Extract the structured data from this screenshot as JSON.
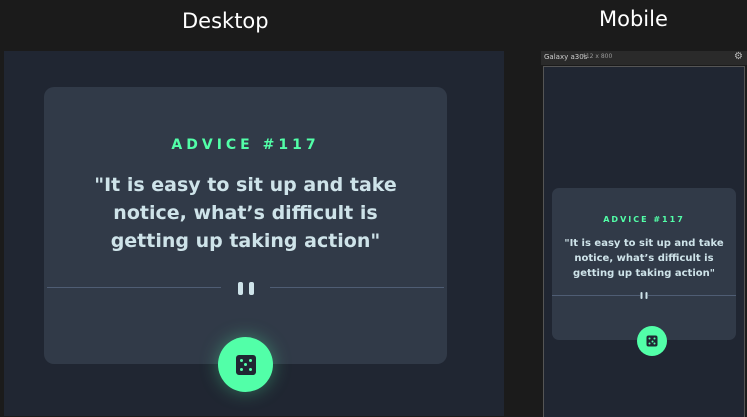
{
  "labels": {
    "desktop": "Desktop",
    "mobile": "Mobile"
  },
  "desktop": {
    "advice_heading": "ADVICE #117",
    "quote": "\"It is easy to sit up and take notice, what’s difficult is getting up taking action\"",
    "dice_icon": "dice-icon",
    "divider_icon": "pause-icon"
  },
  "mobile": {
    "device_name": "Galaxy a30s",
    "device_dimensions": "412 x 800",
    "settings_icon": "gear-icon",
    "advice_heading": "ADVICE #117",
    "quote": "\"It is easy to sit up and take notice, what’s difficult is getting up taking action\"",
    "dice_icon": "dice-icon"
  },
  "colors": {
    "accent": "#52ffa8",
    "card": "#313a48",
    "background": "#202632",
    "text": "#cee3e9"
  }
}
